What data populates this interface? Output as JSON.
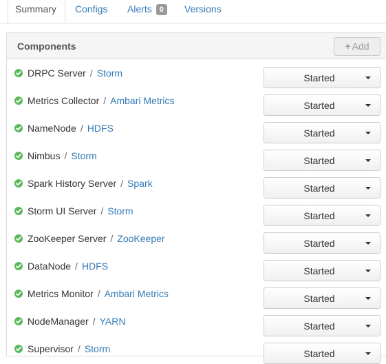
{
  "tabs": [
    {
      "label": "Summary",
      "active": true
    },
    {
      "label": "Configs",
      "active": false
    },
    {
      "label": "Alerts",
      "badge": "0",
      "active": false
    },
    {
      "label": "Versions",
      "active": false
    }
  ],
  "panel": {
    "title": "Components",
    "add_label": "Add",
    "add_icon": "plus-icon"
  },
  "separator": "/",
  "status_icon": "check-circle-icon",
  "status_color": "#5cb85c",
  "link_color": "#337ab7",
  "components": [
    {
      "name": "DRPC Server",
      "service": "Storm",
      "status": "Started"
    },
    {
      "name": "Metrics Collector",
      "service": "Ambari Metrics",
      "status": "Started"
    },
    {
      "name": "NameNode",
      "service": "HDFS",
      "status": "Started"
    },
    {
      "name": "Nimbus",
      "service": "Storm",
      "status": "Started"
    },
    {
      "name": "Spark History Server",
      "service": "Spark",
      "status": "Started"
    },
    {
      "name": "Storm UI Server",
      "service": "Storm",
      "status": "Started"
    },
    {
      "name": "ZooKeeper Server",
      "service": "ZooKeeper",
      "status": "Started"
    },
    {
      "name": "DataNode",
      "service": "HDFS",
      "status": "Started"
    },
    {
      "name": "Metrics Monitor",
      "service": "Ambari Metrics",
      "status": "Started"
    },
    {
      "name": "NodeManager",
      "service": "YARN",
      "status": "Started"
    },
    {
      "name": "Supervisor",
      "service": "Storm",
      "status": "Started"
    }
  ]
}
